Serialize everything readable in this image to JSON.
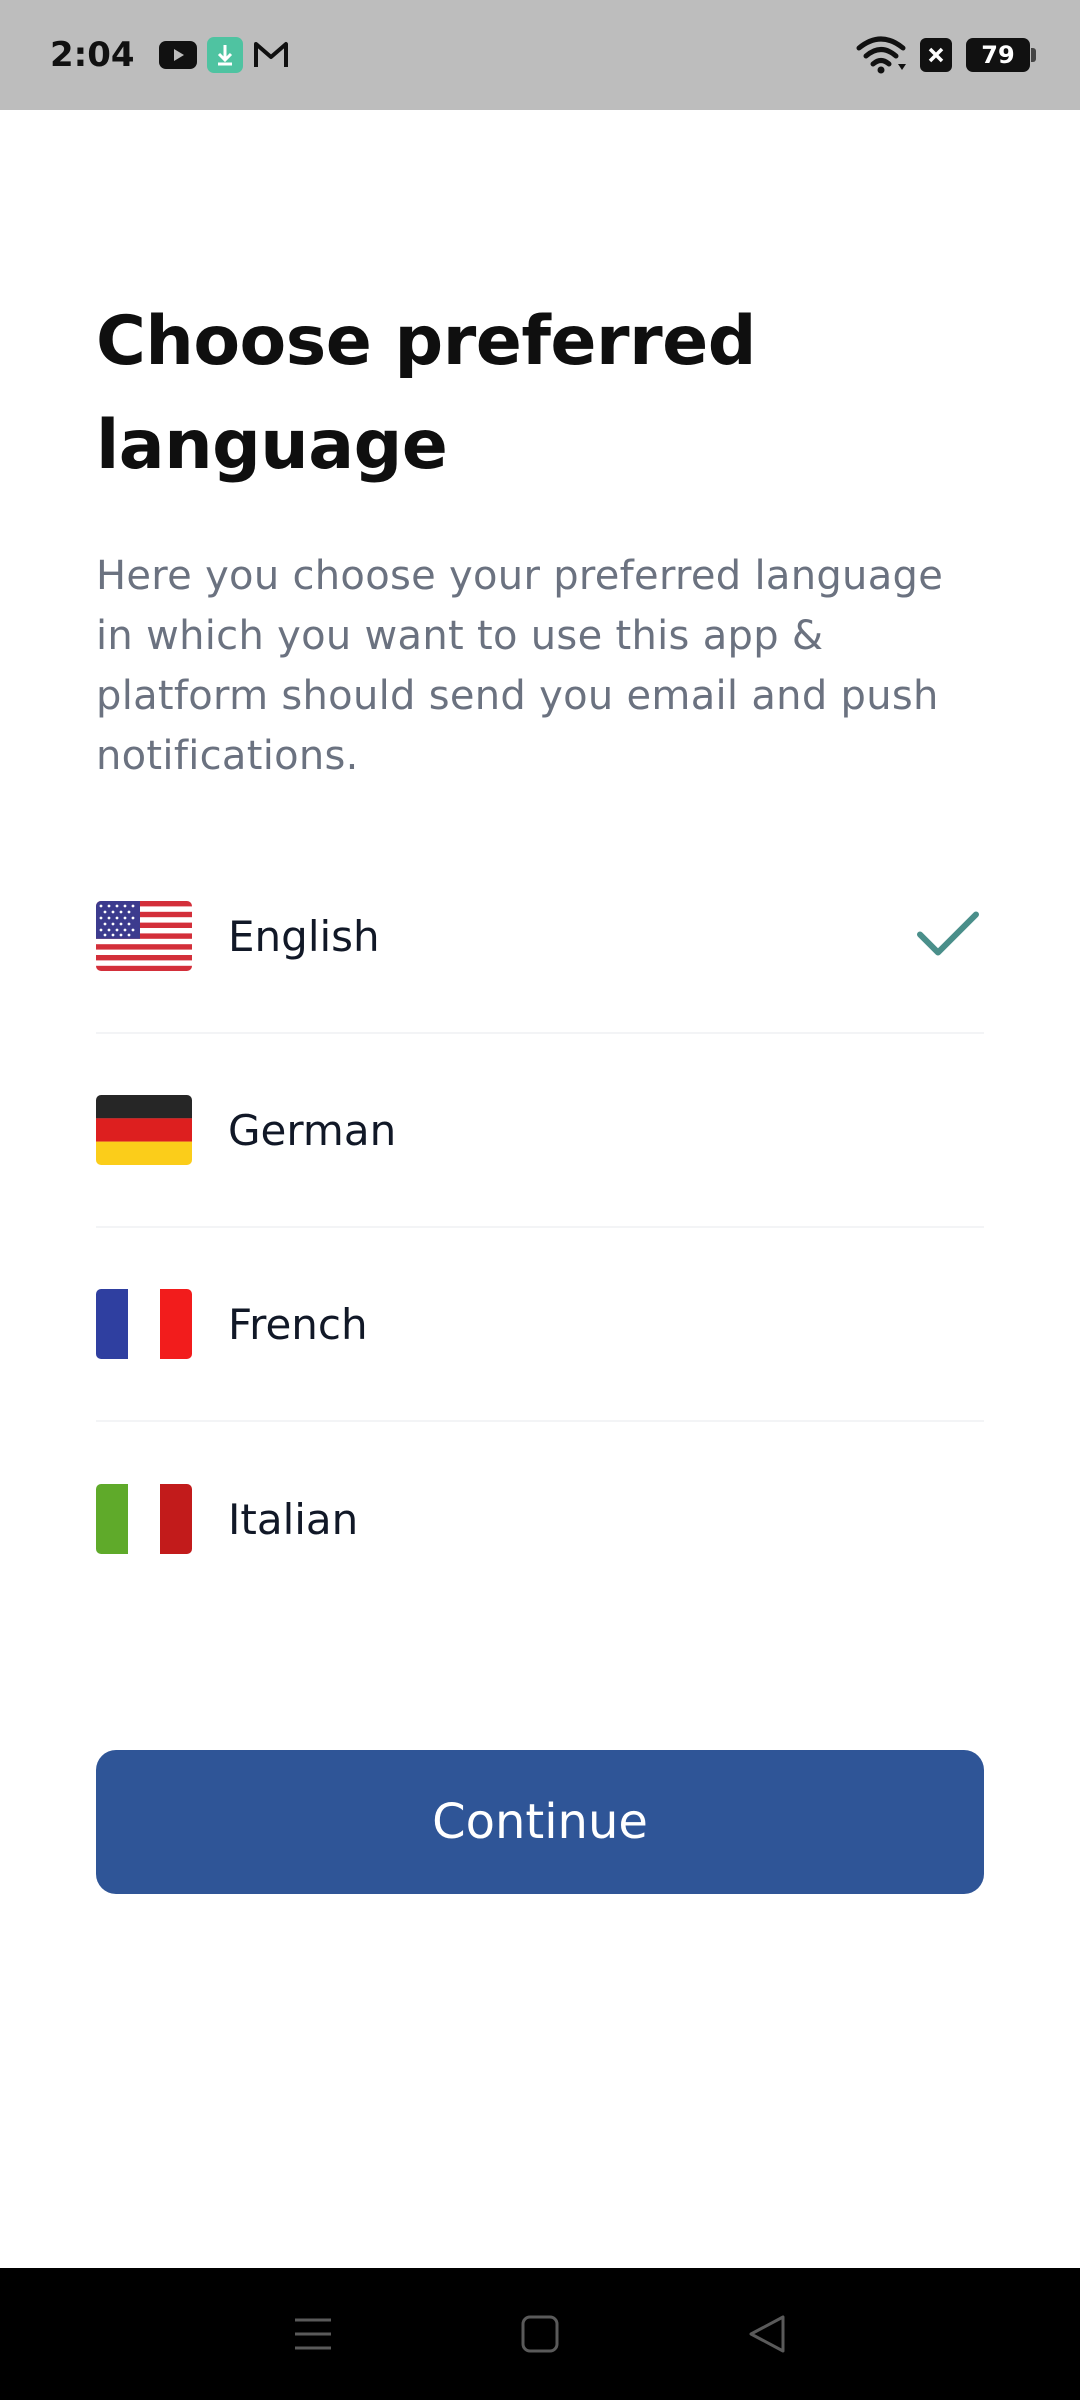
{
  "status_bar": {
    "time": "2:04",
    "battery_level": "79",
    "icons_left": [
      "youtube-icon",
      "download-icon",
      "gmail-icon"
    ],
    "icons_right": [
      "wifi-icon",
      "close-box-icon",
      "battery-icon"
    ]
  },
  "header": {
    "title_line1": "Choose preferred",
    "title_line2": "language",
    "subtitle": "Here you choose your preferred language in which you want to use this app & platform should send you email and push notifications."
  },
  "languages": [
    {
      "label": "English",
      "flag": "us-flag-icon",
      "selected": true
    },
    {
      "label": "German",
      "flag": "germany-flag-icon",
      "selected": false
    },
    {
      "label": "French",
      "flag": "france-flag-icon",
      "selected": false
    },
    {
      "label": "Italian",
      "flag": "italy-flag-icon",
      "selected": false
    }
  ],
  "actions": {
    "continue_label": "Continue"
  },
  "colors": {
    "accent": "#2f5597",
    "check": "#4a8f8a",
    "subtitle": "#6b7280"
  },
  "nav_bar": {
    "icons": [
      "menu-icon",
      "home-square-icon",
      "back-triangle-icon"
    ]
  }
}
